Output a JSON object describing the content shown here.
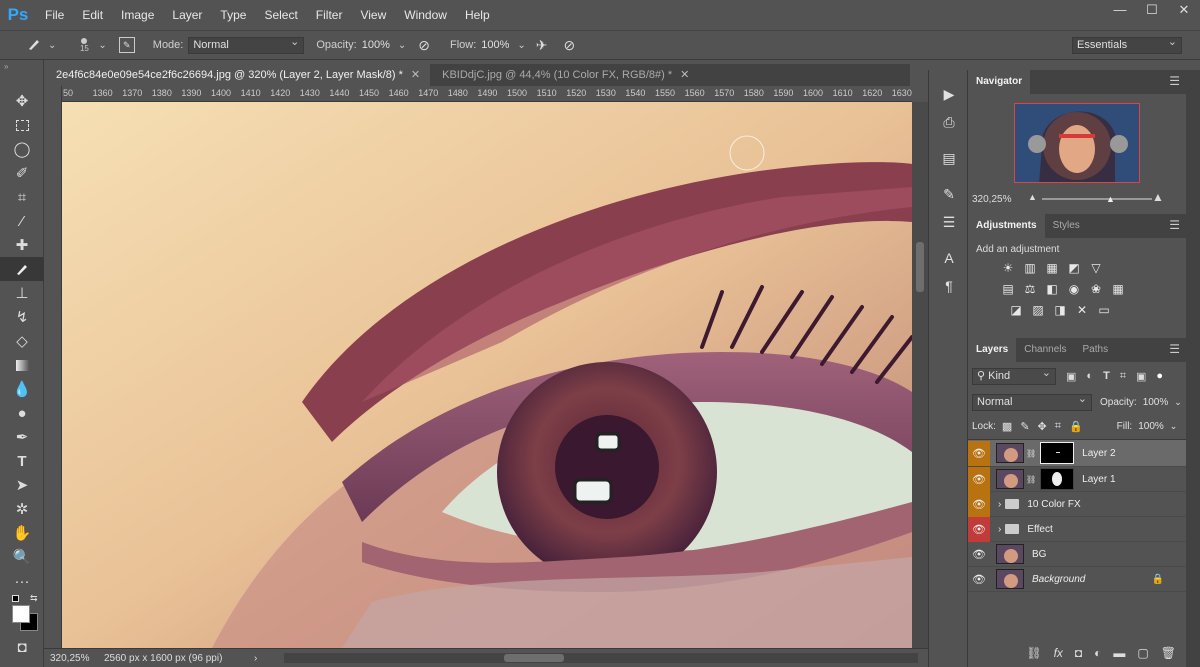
{
  "app": {
    "logo": "Ps"
  },
  "menu": [
    "File",
    "Edit",
    "Image",
    "Layer",
    "Type",
    "Select",
    "Filter",
    "View",
    "Window",
    "Help"
  ],
  "window_controls": [
    "—",
    "☐",
    "✕"
  ],
  "options": {
    "brush_size": "15",
    "mode_label": "Mode:",
    "mode_value": "Normal",
    "opacity_label": "Opacity:",
    "opacity_value": "100%",
    "flow_label": "Flow:",
    "flow_value": "100%",
    "workspace": "Essentials"
  },
  "tabs": [
    {
      "label": "2e4f6c84e0e09e54ce2f6c26694.jpg @ 320% (Layer 2, Layer Mask/8) *",
      "close": "✕"
    },
    {
      "label": "KBIDdjC.jpg @ 44,4% (10 Color FX, RGB/8#) *",
      "close": "✕"
    }
  ],
  "ruler_ticks": [
    "50",
    "1360",
    "1370",
    "1380",
    "1390",
    "1400",
    "1410",
    "1420",
    "1430",
    "1440",
    "1450",
    "1460",
    "1470",
    "1480",
    "1490",
    "1500",
    "1510",
    "1520",
    "1530",
    "1540",
    "1550",
    "1560",
    "1570",
    "1580",
    "1590",
    "1600",
    "1610",
    "1620",
    "1630"
  ],
  "status": {
    "zoom": "320,25%",
    "size": "2560 px x 1600 px (96 ppi)",
    "arrow": "›"
  },
  "navigator": {
    "title": "Navigator",
    "zoom": "320,25%"
  },
  "adjustments": {
    "tab1": "Adjustments",
    "tab2": "Styles",
    "hint": "Add an adjustment"
  },
  "layers_panel": {
    "tab1": "Layers",
    "tab2": "Channels",
    "tab3": "Paths",
    "kind_label": "Kind",
    "blend_mode": "Normal",
    "opacity_label": "Opacity:",
    "opacity_value": "100%",
    "lock_label": "Lock:",
    "fill_label": "Fill:",
    "fill_value": "100%",
    "layers": [
      {
        "name": "Layer 2"
      },
      {
        "name": "Layer 1"
      },
      {
        "name": "10 Color FX"
      },
      {
        "name": "Effect"
      },
      {
        "name": "BG"
      },
      {
        "name": "Background"
      }
    ]
  },
  "colors": {
    "eye_orange": "#b8720f",
    "eye_red": "#c23b3b",
    "selected_layer": "#6a6a6a",
    "ps_blue": "#31a8ff"
  }
}
